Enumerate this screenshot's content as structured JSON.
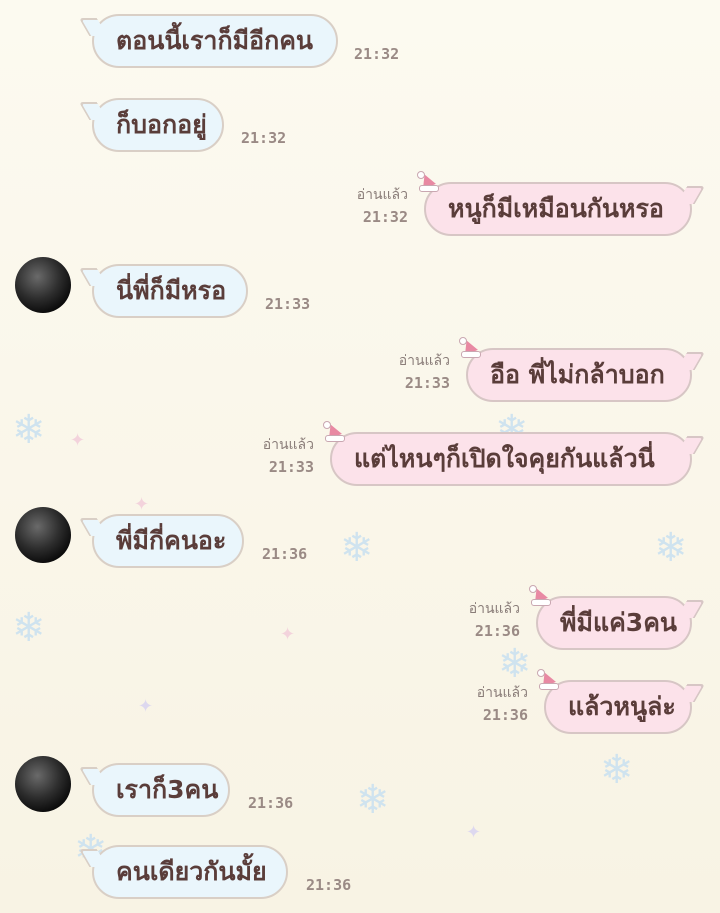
{
  "messages": [
    {
      "text": "ตอนนี้เราก็มีอีกคน",
      "time": "21:32"
    },
    {
      "text": "ก็บอกอยู่",
      "time": "21:32"
    },
    {
      "text": "หนูก็มีเหมือนกันหรอ",
      "time": "21:32",
      "read": "อ่านแล้ว"
    },
    {
      "text": "นี่พี่ก็มีหรอ",
      "time": "21:33"
    },
    {
      "text": "อือ พี่ไม่กล้าบอก",
      "time": "21:33",
      "read": "อ่านแล้ว"
    },
    {
      "text": "แต่ไหนๆก็เปิดใจคุยกันแล้วนี่",
      "time": "21:33",
      "read": "อ่านแล้ว"
    },
    {
      "text": "พี่มีกี่คนอะ",
      "time": "21:36"
    },
    {
      "text": "พี่มีแค่3คน",
      "time": "21:36",
      "read": "อ่านแล้ว"
    },
    {
      "text": "แล้วหนูล่ะ",
      "time": "21:36",
      "read": "อ่านแล้ว"
    },
    {
      "text": "เราก็3คน",
      "time": "21:36"
    },
    {
      "text": "คนเดียวกันมั้ย",
      "time": "21:36"
    }
  ],
  "colors": {
    "incoming_bubble": "#eaf6fc",
    "outgoing_bubble": "#fce2ea",
    "text": "#5a3d3a"
  }
}
